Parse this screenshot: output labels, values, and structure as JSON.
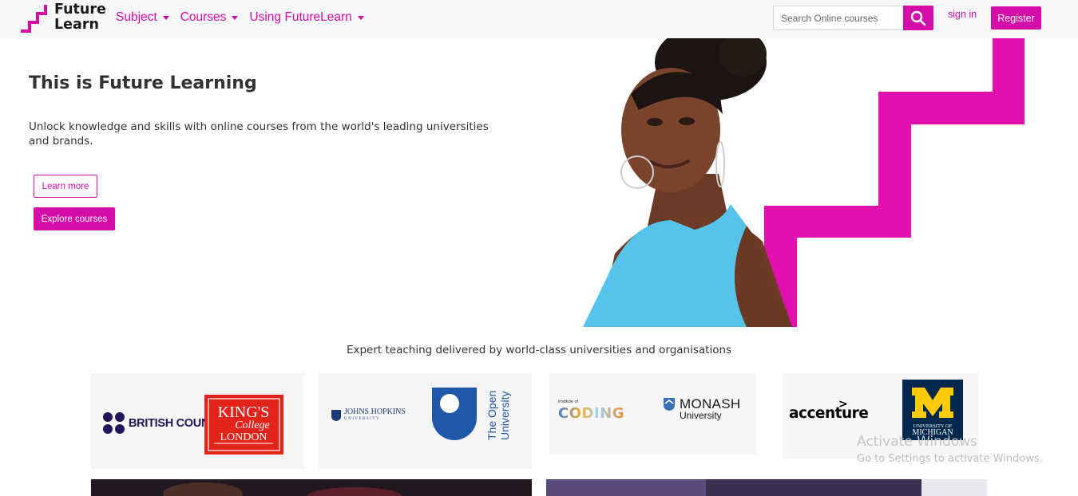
{
  "brand": {
    "line1": "Future",
    "line2": "Learn",
    "accent_color": "#d50da8"
  },
  "nav": {
    "items": [
      {
        "label": "Subject"
      },
      {
        "label": "Courses"
      },
      {
        "label": "Using FutureLearn"
      }
    ],
    "search_placeholder": "Search Online courses",
    "signin_label": "sign in",
    "register_label": "Register"
  },
  "hero": {
    "title": "This is Future Learning",
    "subtitle": "Unlock knowledge and skills with online courses from the world's leading universities and brands.",
    "learn_more_label": "Learn more",
    "explore_label": "Explore courses"
  },
  "partners": {
    "heading": "Expert teaching delivered by world-class universities and organisations",
    "logos": {
      "british_council": "BRITISH COUNCIL",
      "kings_line1": "KING'S",
      "kings_line2": "College",
      "kings_line3": "LONDON",
      "johns_hopkins": "JOHNS HOPKINS",
      "johns_hopkins_sub": "UNIVERSITY",
      "open_university_1": "The Open",
      "open_university_2": "University",
      "ioc_small": "institute of",
      "ioc_big": "CODING",
      "monash_1": "MONASH",
      "monash_2": "University",
      "accenture": "accenture",
      "michigan_1": "UNIVERSITY OF",
      "michigan_2": "MICHIGAN"
    }
  },
  "watermark": {
    "title": "Activate Windows",
    "subtitle": "Go to Settings to activate Windows."
  }
}
